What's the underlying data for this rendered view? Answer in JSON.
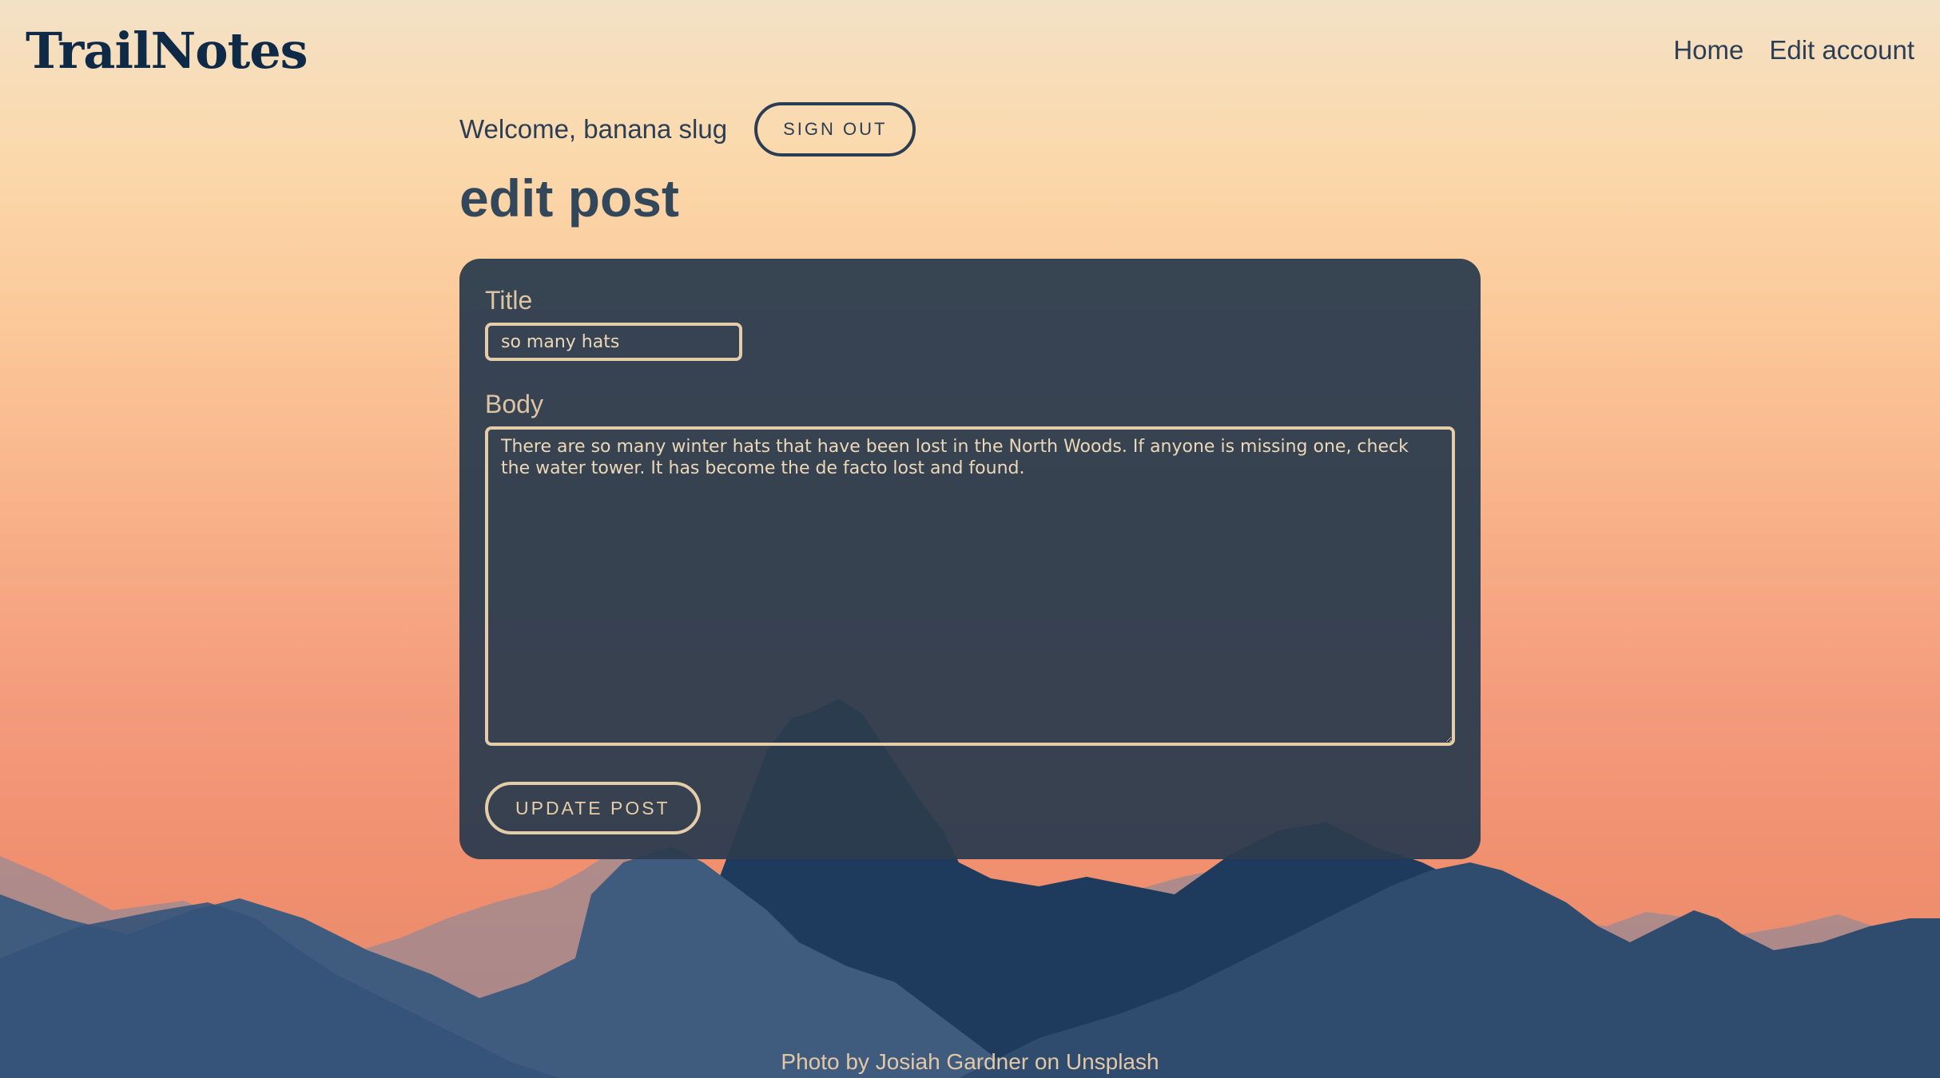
{
  "header": {
    "logo": "TrailNotes",
    "nav": [
      {
        "label": "Home"
      },
      {
        "label": "Edit account"
      }
    ]
  },
  "session": {
    "welcome": "Welcome, banana slug",
    "sign_out_label": "SIGN OUT"
  },
  "page": {
    "title": "edit post"
  },
  "form": {
    "title_label": "Title",
    "title_value": "so many hats",
    "body_label": "Body",
    "body_value": "There are so many winter hats that have been lost in the North Woods. If anyone is missing one, check the water tower. It has become the de facto lost and found.",
    "submit_label": "UPDATE POST"
  },
  "footer": {
    "credit": "Photo by Josiah Gardner on Unsplash"
  },
  "colors": {
    "navy": "#0f2a47",
    "card": "#2c3c4e",
    "accent_cream": "#e6cda9",
    "sky_top": "#f3e1c6",
    "sky_bottom": "#f0906f"
  }
}
